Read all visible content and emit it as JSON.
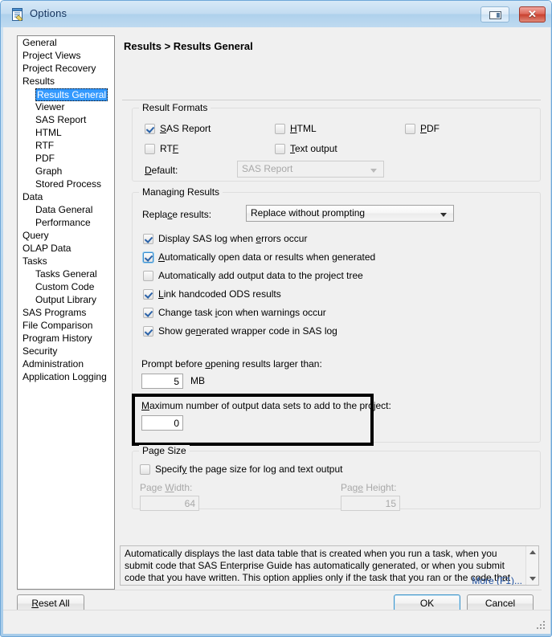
{
  "window": {
    "title": "Options",
    "icon": "options-document-icon",
    "restore_label": "Restore",
    "close_label": "Close"
  },
  "sidebar": {
    "items": [
      {
        "label": "General",
        "level": 0,
        "selected": false
      },
      {
        "label": "Project Views",
        "level": 0,
        "selected": false
      },
      {
        "label": "Project Recovery",
        "level": 0,
        "selected": false
      },
      {
        "label": "Results",
        "level": 0,
        "selected": false
      },
      {
        "label": "Results General",
        "level": 1,
        "selected": true
      },
      {
        "label": "Viewer",
        "level": 1,
        "selected": false
      },
      {
        "label": "SAS Report",
        "level": 1,
        "selected": false
      },
      {
        "label": "HTML",
        "level": 1,
        "selected": false
      },
      {
        "label": "RTF",
        "level": 1,
        "selected": false
      },
      {
        "label": "PDF",
        "level": 1,
        "selected": false
      },
      {
        "label": "Graph",
        "level": 1,
        "selected": false
      },
      {
        "label": "Stored Process",
        "level": 1,
        "selected": false
      },
      {
        "label": "Data",
        "level": 0,
        "selected": false
      },
      {
        "label": "Data General",
        "level": 1,
        "selected": false
      },
      {
        "label": "Performance",
        "level": 1,
        "selected": false
      },
      {
        "label": "Query",
        "level": 0,
        "selected": false
      },
      {
        "label": "OLAP Data",
        "level": 0,
        "selected": false
      },
      {
        "label": "Tasks",
        "level": 0,
        "selected": false
      },
      {
        "label": "Tasks General",
        "level": 1,
        "selected": false
      },
      {
        "label": "Custom Code",
        "level": 1,
        "selected": false
      },
      {
        "label": "Output Library",
        "level": 1,
        "selected": false
      },
      {
        "label": "SAS Programs",
        "level": 0,
        "selected": false
      },
      {
        "label": "File Comparison",
        "level": 0,
        "selected": false
      },
      {
        "label": "Program History",
        "level": 0,
        "selected": false
      },
      {
        "label": "Security",
        "level": 0,
        "selected": false
      },
      {
        "label": "Administration",
        "level": 0,
        "selected": false
      },
      {
        "label": "Application Logging",
        "level": 0,
        "selected": false
      }
    ]
  },
  "pane": {
    "breadcrumb": "Results > Results General"
  },
  "result_formats": {
    "legend": "Result Formats",
    "sas_report": {
      "label": "SAS Report",
      "accel": "S",
      "checked": true
    },
    "html": {
      "label": "HTML",
      "accel": "H",
      "checked": false
    },
    "pdf": {
      "label": "PDF",
      "accel": "P",
      "checked": false
    },
    "rtf": {
      "label": "RTF",
      "accel": "F",
      "checked": false
    },
    "text_output": {
      "label": "Text output",
      "accel": "T",
      "checked": false
    },
    "default_label": "Default:",
    "default_accel": "D",
    "default_value": "SAS Report",
    "default_enabled": false
  },
  "managing_results": {
    "legend": "Managing Results",
    "replace_label": "Replace results:",
    "replace_accel": "c",
    "replace_value": "Replace without prompting",
    "checkboxes": [
      {
        "label": "Display SAS log when errors occur",
        "checked": true,
        "focused": false
      },
      {
        "label": "Automatically open data or results when generated",
        "checked": true,
        "focused": true
      },
      {
        "label": "Automatically add output data to the project tree",
        "checked": false,
        "focused": false
      },
      {
        "label": "Link handcoded ODS results",
        "checked": true,
        "focused": false
      },
      {
        "label": "Change task icon when warnings occur",
        "checked": true,
        "focused": false
      },
      {
        "label": "Show generated wrapper code in SAS log",
        "checked": true,
        "focused": false
      }
    ],
    "prompt_label": "Prompt before opening results larger than:",
    "prompt_value": "5",
    "prompt_units": "MB",
    "max_datasets_label": "Maximum number of output data sets to add to the project:",
    "max_datasets_value": "0"
  },
  "page_size": {
    "legend": "Page Size",
    "specify_label": "Specify the page size for log and text output",
    "specify_checked": false,
    "width_label": "Page Width:",
    "width_value": "64",
    "height_label": "Page Height:",
    "height_value": "15",
    "fields_enabled": false
  },
  "description": {
    "text": "Automatically displays the last data table that is created when you run a task, when you submit code that SAS Enterprise Guide has automatically generated, or when you submit code that you have written. This option applies only if the task that you ran or the code that you submitted creates output data and no",
    "more_link": "More (F1)..."
  },
  "buttons": {
    "reset_all": "Reset All",
    "ok": "OK",
    "cancel": "Cancel"
  },
  "colors": {
    "selection": "#3399ff",
    "annotation": "#000000",
    "link": "#1d4fa0",
    "title_text": "#14325c",
    "close_button": "#c9412f"
  }
}
